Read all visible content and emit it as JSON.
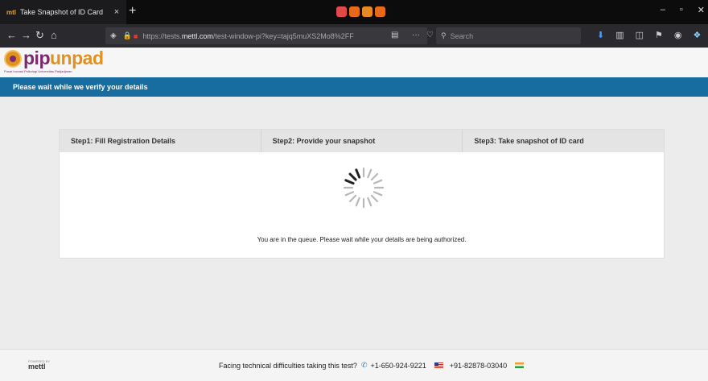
{
  "browser": {
    "tab_title": "Take Snapshot of ID Card",
    "tab_favicon_text": "mtl",
    "tab_close": "×",
    "new_tab": "+",
    "url_prefix": "https://tests.",
    "url_domain": "mettl.com",
    "url_path": "/test-window-pi?key=tajq5muXS2Mo8%2FF",
    "search_placeholder": "Search",
    "window_controls": {
      "minimize": "–",
      "maximize": "▫",
      "close": "✕"
    },
    "icons": [
      "back-icon",
      "forward-icon",
      "reload-icon",
      "home-icon",
      "shield-icon",
      "lock-icon",
      "camera-icon",
      "reader-icon",
      "more-icon",
      "pocket-icon",
      "bookmark-star-icon",
      "search-icon",
      "downloads-icon",
      "library-icon",
      "sidebar-icon",
      "extension-icon",
      "account-icon",
      "menu-icon"
    ]
  },
  "brand": {
    "logo_text_main": "pip",
    "logo_text_accent": "unpad",
    "logo_subtitle": "Pusat Inovasi Psikologi Universitas Padjadjaran",
    "colors": {
      "purple": "#7b2a6e",
      "orange": "#e0921c"
    }
  },
  "banner": {
    "text": "Please wait while we verify your details",
    "color": "#176ca0"
  },
  "steps": [
    {
      "label": "Step1: Fill Registration Details"
    },
    {
      "label": "Step2: Provide your snapshot"
    },
    {
      "label": "Step3: Take snapshot of ID card"
    }
  ],
  "status_message": "You are in the queue. Please wait while your details are being authorized.",
  "footer": {
    "powered_by": "POWERED BY",
    "powered_logo": "mettl",
    "help_text": "Facing technical difficulties taking this test?",
    "phone_us": "+1-650-924-9221",
    "phone_in": "+91-82878-03040"
  }
}
